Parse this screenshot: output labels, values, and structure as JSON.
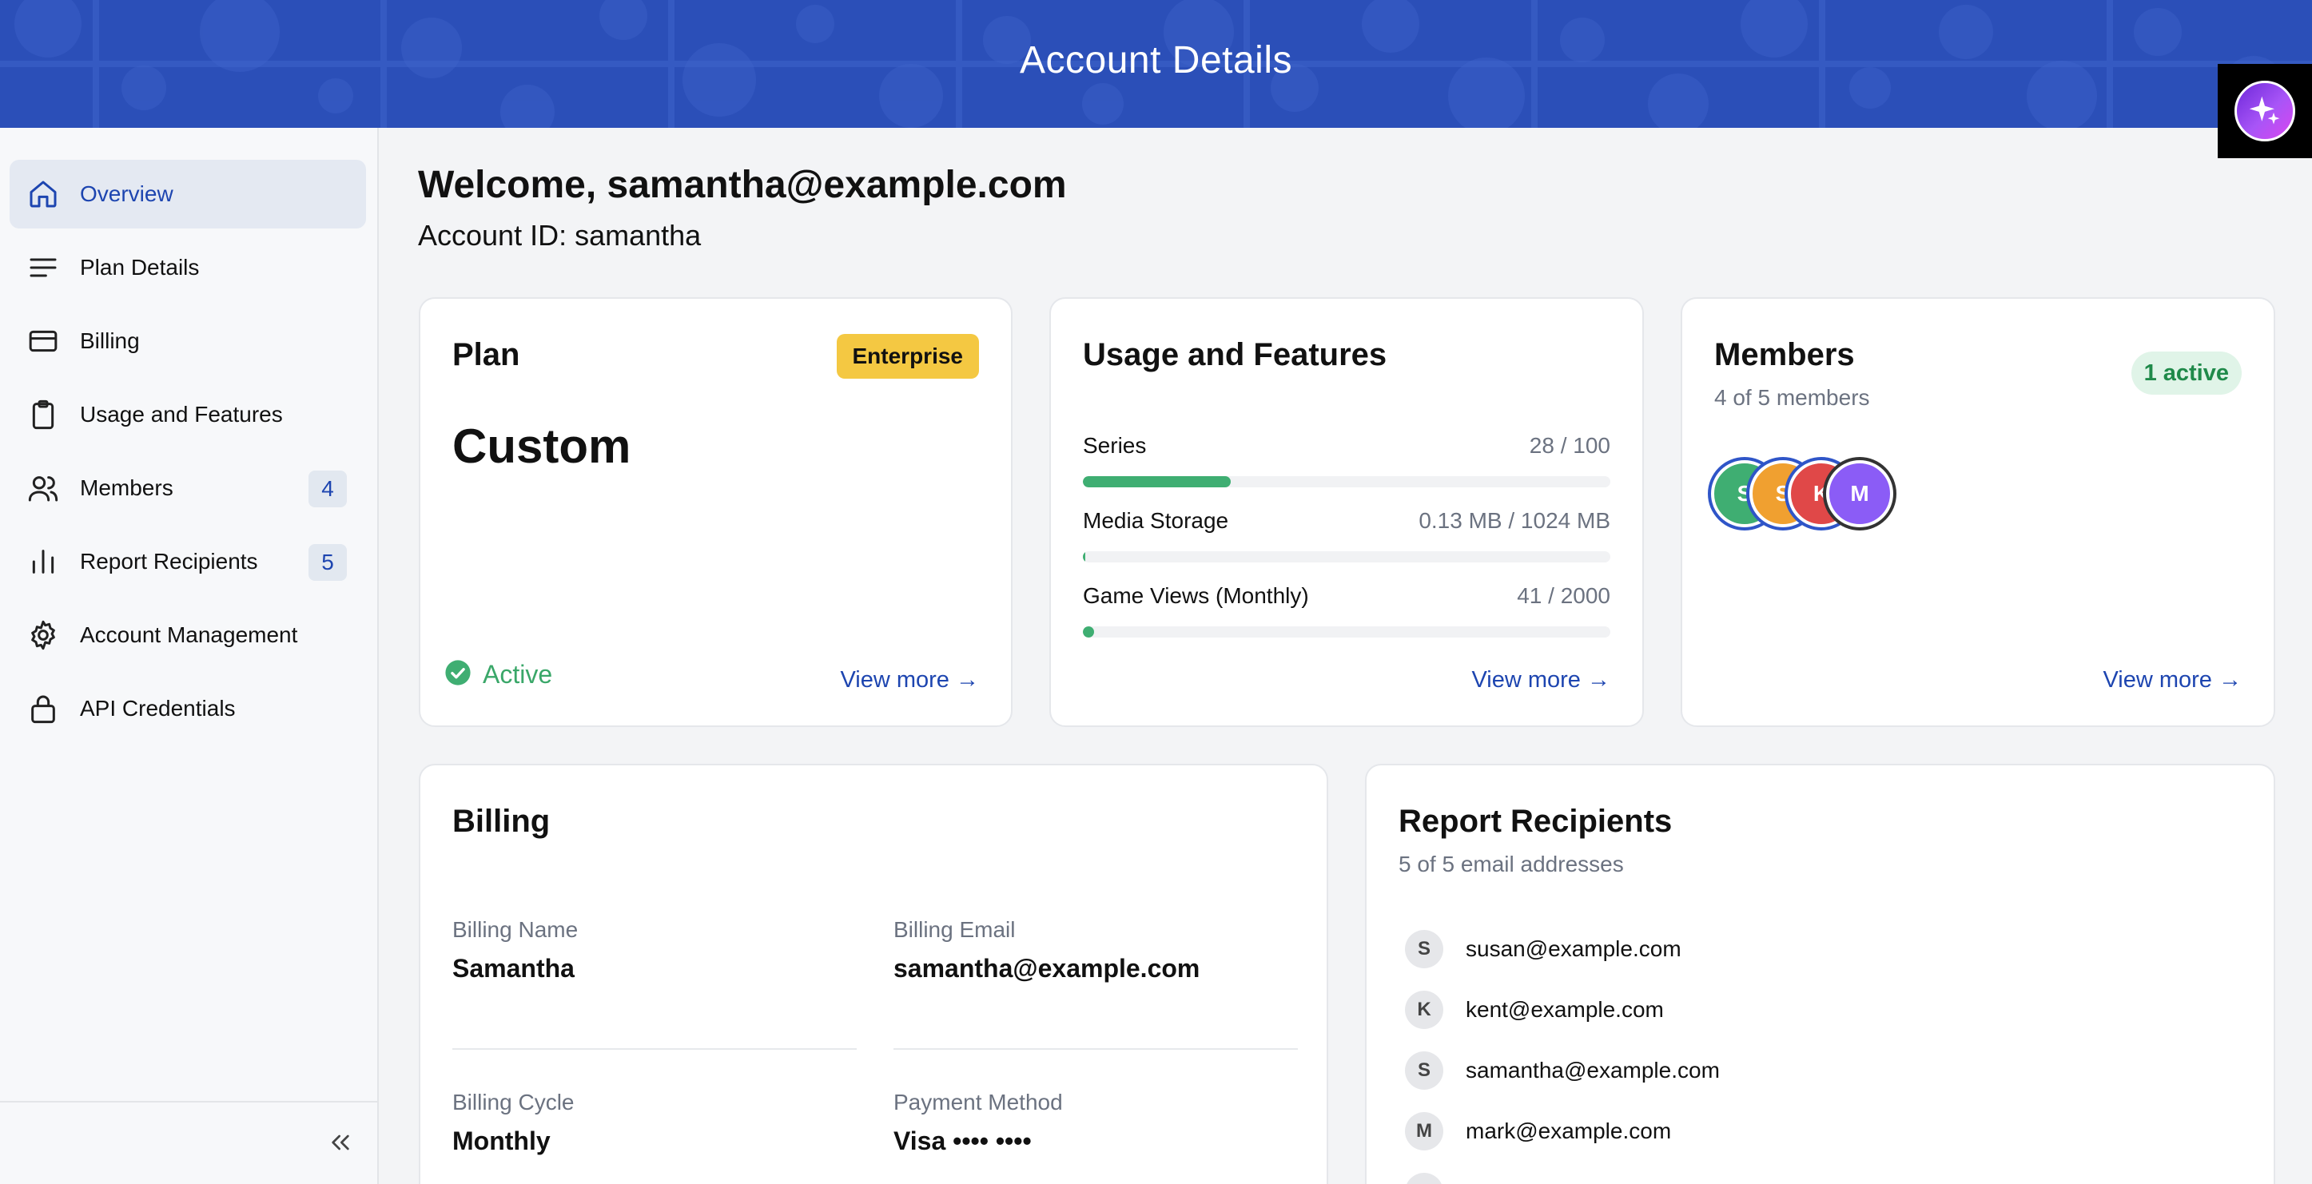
{
  "header": {
    "title": "Account Details",
    "ai_button_icon": "sparkles-icon"
  },
  "sidebar": {
    "items": [
      {
        "label": "Overview",
        "icon": "home-icon",
        "active": true
      },
      {
        "label": "Plan Details",
        "icon": "list-icon"
      },
      {
        "label": "Billing",
        "icon": "credit-card-icon"
      },
      {
        "label": "Usage and Features",
        "icon": "clipboard-icon"
      },
      {
        "label": "Members",
        "icon": "users-icon",
        "badge": "4"
      },
      {
        "label": "Report Recipients",
        "icon": "bar-chart-icon",
        "badge": "5"
      },
      {
        "label": "Account Management",
        "icon": "gear-icon"
      },
      {
        "label": "API Credentials",
        "icon": "lock-icon"
      }
    ],
    "collapse_icon": "chevrons-left-icon"
  },
  "main": {
    "welcome": "Welcome, samantha@example.com",
    "account_id": "Account ID: samantha"
  },
  "plan_card": {
    "title": "Plan",
    "tier": "Enterprise",
    "plan_name": "Custom",
    "status": "Active",
    "view_more": "View more →"
  },
  "usage_card": {
    "title": "Usage and Features",
    "items": [
      {
        "label": "Series",
        "value": "28 / 100",
        "fraction": 0.28
      },
      {
        "label": "Media Storage",
        "value": "0.13 MB / 1024 MB",
        "fraction": 0.0001
      },
      {
        "label": "Game Views (Monthly)",
        "value": "41 / 2000",
        "fraction": 0.0205
      }
    ],
    "view_more": "View more →"
  },
  "members_card": {
    "title": "Members",
    "subtitle": "4 of 5 members",
    "active_pill": "1 active",
    "avatars": [
      {
        "initial": "S",
        "color": "#3fae72"
      },
      {
        "initial": "S",
        "color": "#f0a030"
      },
      {
        "initial": "K",
        "color": "#e04848"
      },
      {
        "initial": "M",
        "color": "#8b5cf6"
      }
    ],
    "view_more": "View more →"
  },
  "billing_card": {
    "title": "Billing",
    "billing_name_label": "Billing Name",
    "billing_name": "Samantha",
    "billing_email_label": "Billing Email",
    "billing_email": "samantha@example.com",
    "billing_cycle_label": "Billing Cycle",
    "billing_cycle": "Monthly",
    "payment_method_label": "Payment Method",
    "payment_method": "Visa •••• ••••"
  },
  "recipients_card": {
    "title": "Report Recipients",
    "subtitle": "5 of 5 email addresses",
    "recipients": [
      {
        "initial": "S",
        "email": "susan@example.com"
      },
      {
        "initial": "K",
        "email": "kent@example.com"
      },
      {
        "initial": "S",
        "email": "samantha@example.com"
      },
      {
        "initial": "M",
        "email": "mark@example.com"
      }
    ]
  },
  "colors": {
    "brand": "#2b4fb8",
    "link": "#1d45b0",
    "success": "#3fae72",
    "badge": "#f4c842"
  }
}
